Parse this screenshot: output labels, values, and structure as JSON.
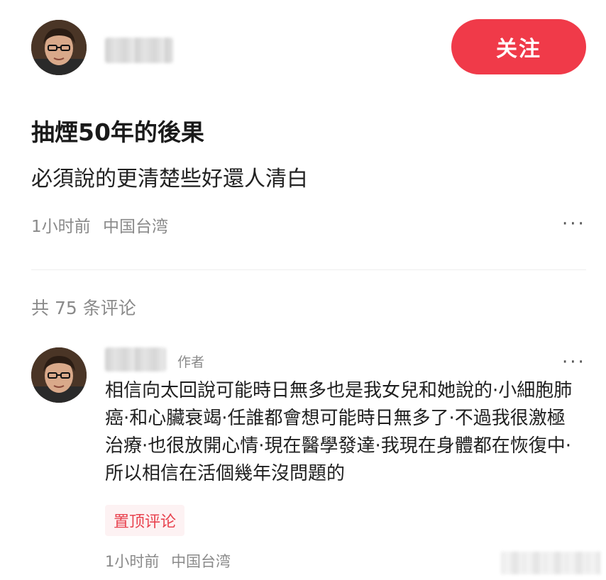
{
  "post": {
    "follow_label": "关注",
    "title": "抽煙50年的後果",
    "subtitle": "必須說的更清楚些好還人清白",
    "time": "1小时前",
    "location": "中国台湾",
    "more_label": "···"
  },
  "comments_header": {
    "count_label": "共 75 条评论"
  },
  "comment": {
    "author_tag": "作者",
    "more_label": "···",
    "text": "相信向太回說可能時日無多也是我女兒和她說的·小細胞肺癌·和心臟衰竭·任誰都會想可能時日無多了·不過我很激極治療·也很放開心情·現在醫學發達·我現在身體都在恢復中·所以相信在活個幾年沒問題的",
    "pinned_label": "置顶评论",
    "time": "1小时前",
    "location": "中国台湾"
  },
  "colors": {
    "accent": "#f03a49",
    "muted_text": "#8a8a8a",
    "pinned_bg": "#fdf2f3",
    "pinned_text": "#e8434f"
  },
  "icons": {
    "avatar": "portrait-avatar",
    "more": "more-dots-icon"
  }
}
